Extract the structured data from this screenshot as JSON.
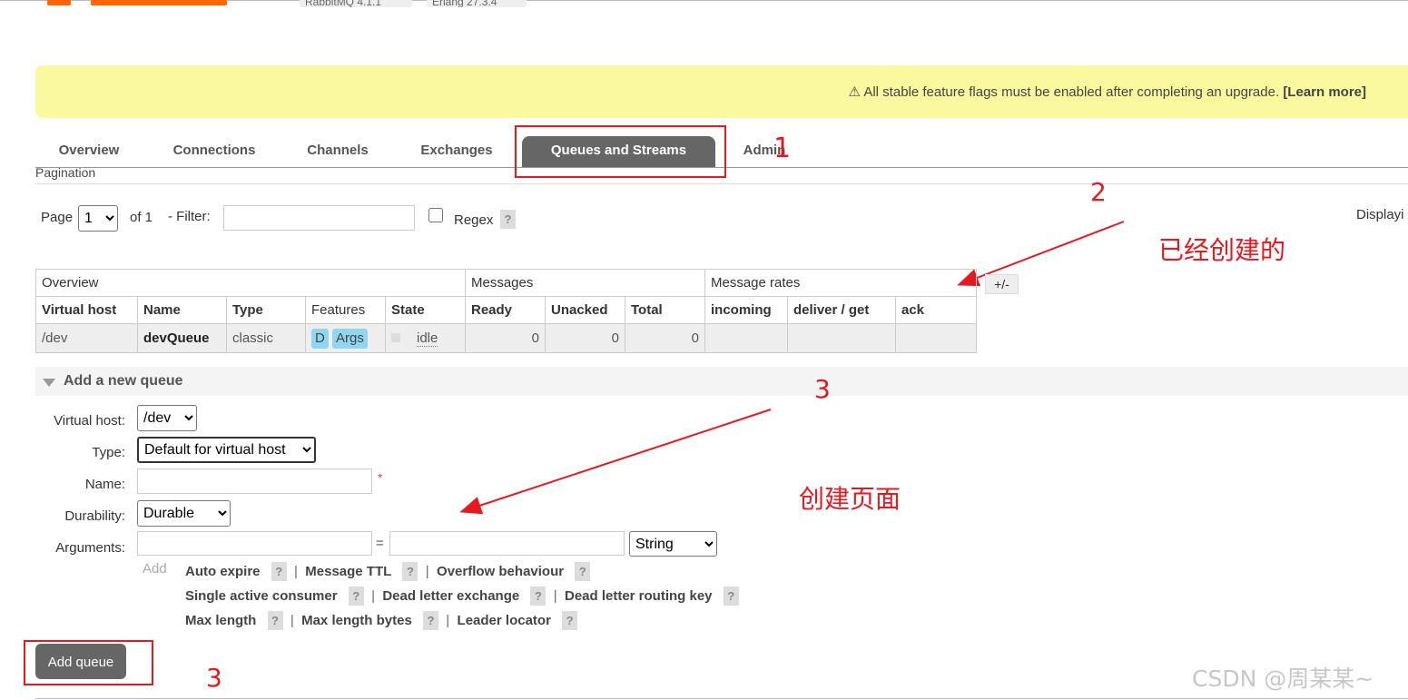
{
  "header": {
    "rabbitmq_version": "RabbitMQ 4.1.1",
    "erlang_version": "Erlang 27.3.4",
    "brand_color": "#ff6600"
  },
  "banner": {
    "icon": "warning-icon",
    "text": "All stable feature flags must be enabled after completing an upgrade.",
    "link": "[Learn more]"
  },
  "tabs": [
    {
      "label": "Overview"
    },
    {
      "label": "Connections"
    },
    {
      "label": "Channels"
    },
    {
      "label": "Exchanges"
    },
    {
      "label": "Queues and Streams",
      "active": true
    },
    {
      "label": "Admin"
    }
  ],
  "pagination": {
    "section_title": "Pagination",
    "page_label": "Page",
    "page_value": "1",
    "of_label": "of 1",
    "filter_label": "- Filter:",
    "filter_value": "",
    "regex_label": "Regex",
    "help": "?",
    "displaying": "Displayi"
  },
  "queue_table": {
    "groups": [
      "Overview",
      "Messages",
      "Message rates"
    ],
    "columns": [
      "Virtual host",
      "Name",
      "Type",
      "Features",
      "State",
      "Ready",
      "Unacked",
      "Total",
      "incoming",
      "deliver / get",
      "ack"
    ],
    "toggle_label": "+/-",
    "rows": [
      {
        "vhost": "/dev",
        "name": "devQueue",
        "type": "classic",
        "feature_d": "D",
        "feature_args": "Args",
        "state": "idle",
        "ready": "0",
        "unacked": "0",
        "total": "0",
        "incoming": "",
        "deliver_get": "",
        "ack": ""
      }
    ]
  },
  "add_queue": {
    "title": "Add a new queue",
    "vhost_label": "Virtual host:",
    "vhost_value": "/dev",
    "type_label": "Type:",
    "type_value": "Default for virtual host",
    "name_label": "Name:",
    "name_value": "",
    "required_mark": "*",
    "durability_label": "Durability:",
    "durability_value": "Durable",
    "arguments_label": "Arguments:",
    "equals": "=",
    "arg_type_value": "String",
    "add_label": "Add",
    "arg_links": [
      [
        "Auto expire",
        "Message TTL",
        "Overflow behaviour"
      ],
      [
        "Single active consumer",
        "Dead letter exchange",
        "Dead letter routing key"
      ],
      [
        "Max length",
        "Max length bytes",
        "Leader locator"
      ]
    ],
    "submit_label": "Add queue"
  },
  "annotations": {
    "step1": "1",
    "step2": "2",
    "step2_note": "已经创建的",
    "step3": "3",
    "step3_note": "创建页面",
    "step3_button": "3",
    "color": "#e5191f"
  },
  "watermark": "CSDN @周某某~"
}
